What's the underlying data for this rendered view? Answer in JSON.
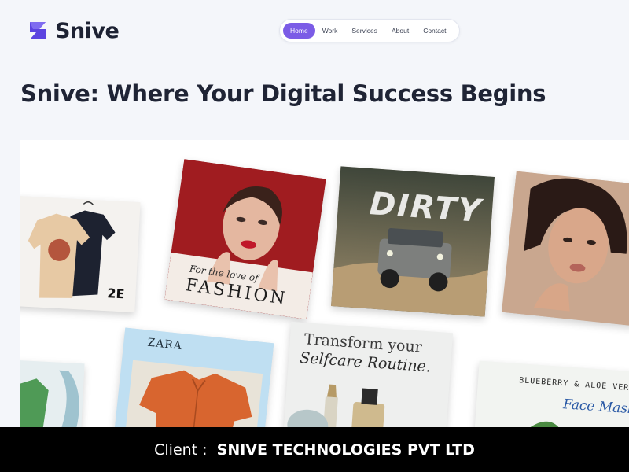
{
  "brand": {
    "name": "Snive",
    "accent": "#7b5ce6",
    "logo_color": "#5b43e0"
  },
  "nav": {
    "items": [
      {
        "label": "Home",
        "active": true
      },
      {
        "label": "Work",
        "active": false
      },
      {
        "label": "Services",
        "active": false
      },
      {
        "label": "About",
        "active": false
      },
      {
        "label": "Contact",
        "active": false
      }
    ]
  },
  "hero": {
    "title": "Snive: Where Your Digital Success Begins"
  },
  "portfolio": {
    "tiles": [
      {
        "subject": "t-shirts-on-hangers",
        "caption": "2E"
      },
      {
        "subject": "fashion-model-red-nails",
        "caption_script": "For the love of",
        "caption_main": "FASHION"
      },
      {
        "subject": "offroad-jeep",
        "caption": "DIRTY"
      },
      {
        "subject": "beauty-portrait"
      },
      {
        "subject": "green-shirt"
      },
      {
        "subject": "orange-shirt",
        "caption": "ZARA"
      },
      {
        "subject": "selfcare-serum",
        "caption_line1": "Transform your",
        "caption_line2": "Selfcare Routine."
      },
      {
        "subject": "face-mask-product",
        "caption_small": "BLUEBERRY & ALOE VER",
        "caption_main": "Face Mask"
      }
    ]
  },
  "footer": {
    "prefix": "Client : ",
    "client": "SNIVE TECHNOLOGIES PVT LTD"
  }
}
